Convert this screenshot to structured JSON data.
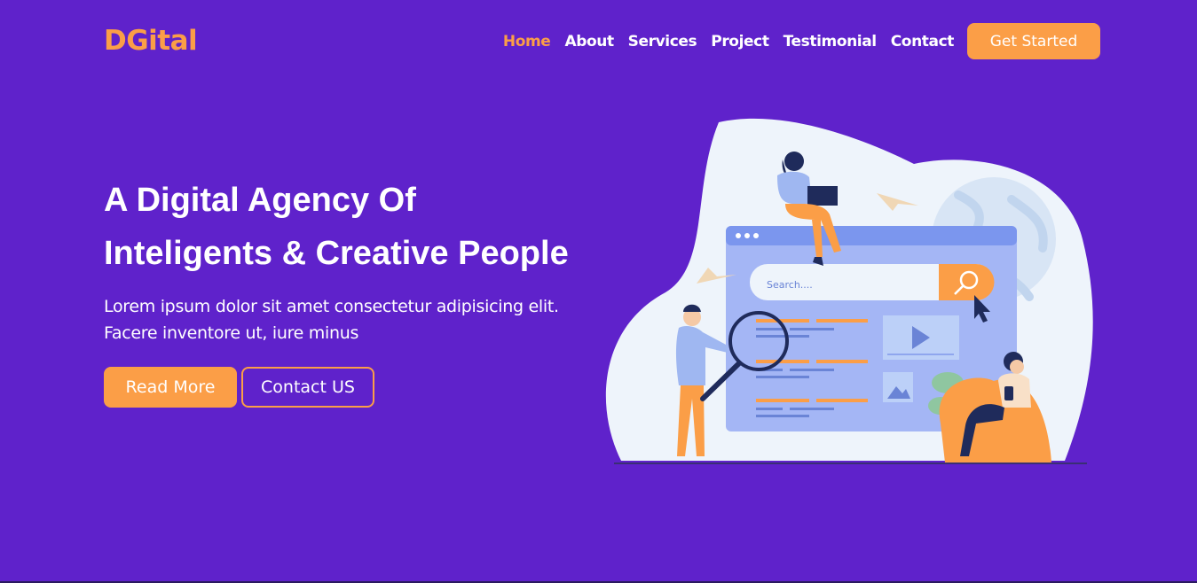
{
  "brand": {
    "name": "DGital"
  },
  "nav": {
    "items": [
      {
        "label": "Home",
        "active": true
      },
      {
        "label": "About"
      },
      {
        "label": "Services"
      },
      {
        "label": "Project"
      },
      {
        "label": "Testimonial"
      },
      {
        "label": "Contact"
      }
    ],
    "cta_label": "Get Started"
  },
  "hero": {
    "title_line1": "A Digital Agency Of",
    "title_line2": "Inteligents & Creative People",
    "text": "Lorem ipsum dolor sit amet consectetur adipisicing elit. Facere inventore ut, iure minus",
    "primary_button": "Read More",
    "secondary_button": "Contact US"
  },
  "illustration": {
    "search_placeholder": "Search...."
  },
  "colors": {
    "background": "#5f22cb",
    "accent": "#fb9e47",
    "text": "#ffffff"
  }
}
